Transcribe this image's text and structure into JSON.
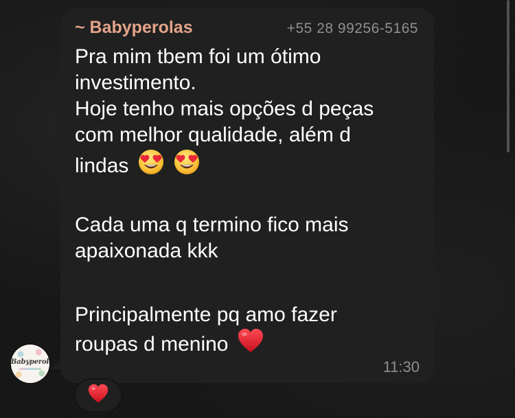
{
  "message": {
    "sender_name": "~ Babyperolas",
    "sender_phone": "+55 28 99256-5165",
    "lines": [
      "Pra mim tbem foi um ótimo",
      "investimento.",
      "Hoje tenho mais opções d peças",
      "com melhor qualidade, além d",
      "lindas",
      "",
      "Cada uma q termino fico mais",
      "apaixonada kkk",
      "",
      "Principalmente pq amo fazer",
      "roupas d menino"
    ],
    "emoji_lindas": [
      "smiling-face-with-heart-eyes",
      "smiling-face-with-heart-eyes"
    ],
    "emoji_menino": "red-heart",
    "timestamp": "11:30"
  },
  "avatar": {
    "label": "Babyperolas"
  },
  "reaction": {
    "emoji": "red-heart"
  },
  "colors": {
    "bubble": "#202020",
    "sender_name": "#e3a48a",
    "meta_text": "#8f8f8f",
    "message_text": "#ffffff",
    "heart": "#e0242f"
  }
}
